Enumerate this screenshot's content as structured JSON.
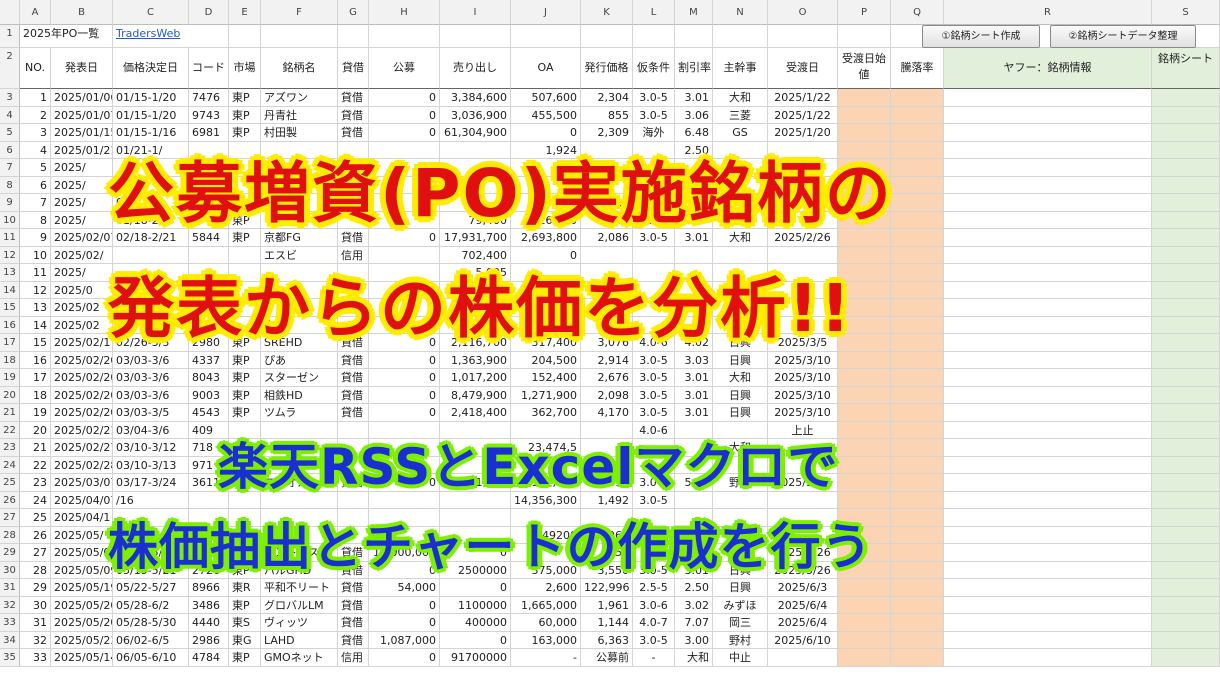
{
  "columns": [
    "A",
    "B",
    "C",
    "D",
    "E",
    "F",
    "G",
    "H",
    "I",
    "J",
    "K",
    "L",
    "M",
    "N",
    "O",
    "P",
    "Q",
    "R",
    "S"
  ],
  "row1": {
    "title": "2025年PO一覧",
    "link": "TradersWeb",
    "btn1": "①銘柄シート作成",
    "btn2": "②銘柄シートデータ整理"
  },
  "header": [
    "NO.",
    "発表日",
    "価格決定日",
    "コード",
    "市場",
    "銘柄名",
    "貸借",
    "公募",
    "売り出し",
    "OA",
    "発行価格",
    "仮条件",
    "割引率",
    "主幹事",
    "受渡日",
    "受渡日始値",
    "騰落率",
    "ヤフー：銘柄情報",
    "銘柄シート"
  ],
  "rows": [
    [
      "1",
      "2025/01/06",
      "01/15-1/20",
      "7476",
      "東P",
      "アズワン",
      "貸借",
      "0",
      "3,384,600",
      "507,600",
      "2,304",
      "3.0-5",
      "3.01",
      "大和",
      "2025/1/22"
    ],
    [
      "2",
      "2025/01/07",
      "01/15-1/20",
      "9743",
      "東P",
      "丹青社",
      "貸借",
      "0",
      "3,036,900",
      "455,500",
      "855",
      "3.0-5",
      "3.06",
      "三菱",
      "2025/1/22"
    ],
    [
      "3",
      "2025/01/15",
      "01/15-1/16",
      "6981",
      "東P",
      "村田製",
      "貸借",
      "0",
      "61,304,900",
      "0",
      "2,309",
      "海外",
      "6.48",
      "GS",
      "2025/1/20"
    ],
    [
      "4",
      "2025/01/21",
      "01/21-1/",
      "",
      "",
      "",
      "",
      "",
      "",
      "1,924",
      "",
      "",
      "2.50",
      "",
      ""
    ],
    [
      "5",
      "2025/",
      "",
      "",
      "",
      "",
      "",
      "",
      "",
      "",
      "",
      "",
      "",
      "",
      ""
    ],
    [
      "6",
      "2025/",
      "",
      "",
      "",
      "",
      "",
      "",
      "",
      "",
      "",
      "",
      "10.",
      "",
      ""
    ],
    [
      "7",
      "2025/",
      "01/17-2/",
      "",
      "",
      "",
      "",
      "",
      "",
      "920,9",
      "138,0",
      "",
      "3.5-",
      "",
      ""
    ],
    [
      "8",
      "2025/",
      "01/18-2/",
      "",
      "東P",
      "",
      "",
      "",
      "79,400",
      "116,900",
      "2,083",
      "3.",
      "",
      "",
      ""
    ],
    [
      "9",
      "2025/02/07",
      "02/18-2/21",
      "5844",
      "東P",
      "京都FG",
      "貸借",
      "0",
      "17,931,700",
      "2,693,800",
      "2,086",
      "3.0-5",
      "3.01",
      "大和",
      "2025/2/26"
    ],
    [
      "10",
      "2025/02/",
      "",
      "",
      "",
      "エスビ",
      "信用",
      "",
      "702,400",
      "0",
      "",
      "",
      "",
      "",
      ""
    ],
    [
      "11",
      "2025/",
      "",
      "",
      "",
      "",
      "",
      "",
      "5,095",
      "",
      "",
      "",
      "",
      "",
      ""
    ],
    [
      "12",
      "2025/0",
      "",
      "",
      "",
      "",
      "",
      "",
      "7,6",
      "",
      "",
      "",
      "",
      "",
      ""
    ],
    [
      "13",
      "2025/02",
      "",
      "",
      "",
      "",
      "",
      "",
      "2,70",
      "",
      "",
      "",
      "",
      "",
      ""
    ],
    [
      "14",
      "2025/02",
      "",
      "19",
      "",
      "高砂",
      "",
      "",
      "3,106,800",
      "466,000",
      "",
      "",
      "",
      "",
      ""
    ],
    [
      "15",
      "2025/02/17",
      "02/26-3/3",
      "2980",
      "東P",
      "SREHD",
      "貸借",
      "0",
      "2,116,700",
      "317,400",
      "3,076",
      "4.0-6",
      "4.02",
      "日興",
      "2025/3/5"
    ],
    [
      "16",
      "2025/02/20",
      "03/03-3/6",
      "4337",
      "東P",
      "ぴあ",
      "貸借",
      "0",
      "1,363,900",
      "204,500",
      "2,914",
      "3.0-5",
      "3.03",
      "日興",
      "2025/3/10"
    ],
    [
      "17",
      "2025/02/20",
      "03/03-3/6",
      "8043",
      "東P",
      "スターゼン",
      "貸借",
      "0",
      "1,017,200",
      "152,400",
      "2,676",
      "3.0-5",
      "3.01",
      "大和",
      "2025/3/10"
    ],
    [
      "18",
      "2025/02/20",
      "03/03-3/6",
      "9003",
      "東P",
      "相鉄HD",
      "貸借",
      "0",
      "8,479,900",
      "1,271,900",
      "2,098",
      "3.0-5",
      "3.01",
      "日興",
      "2025/3/10"
    ],
    [
      "19",
      "2025/02/20",
      "03/03-3/5",
      "4543",
      "東P",
      "ツムラ",
      "貸借",
      "0",
      "2,418,400",
      "362,700",
      "4,170",
      "3.0-5",
      "3.01",
      "日興",
      "2025/3/10"
    ],
    [
      "20",
      "2025/02/21",
      "03/04-3/6",
      "409",
      "",
      "",
      "",
      "",
      "",
      "",
      "",
      "4.0-6",
      "",
      "",
      "上止"
    ],
    [
      "21",
      "2025/02/27",
      "03/10-3/12",
      "718",
      "",
      "",
      "",
      "",
      "",
      "23,474,5",
      "",
      "",
      "",
      "大和",
      ""
    ],
    [
      "22",
      "2025/02/28",
      "03/10-3/13",
      "971",
      "",
      "",
      "",
      "",
      "",
      "",
      "",
      "",
      "",
      "",
      ""
    ],
    [
      "23",
      "2025/03/07",
      "03/17-3/24",
      "3611",
      "東S",
      "マツオカ",
      "貸借",
      "0",
      "1,081,200",
      "162,100",
      "1,816",
      "3.0-5",
      "5.02",
      "野村",
      "2025/3/25"
    ],
    [
      "24",
      "2025/04/07",
      "/16",
      "",
      "",
      "",
      "",
      "",
      "",
      "14,356,300",
      "1,492",
      "3.0-5",
      "",
      "",
      ""
    ],
    [
      "25",
      "2025/04/1",
      "",
      "",
      "",
      "",
      "",
      "",
      "",
      "",
      "",
      "",
      "",
      "",
      ""
    ],
    [
      "26",
      "2025/05/",
      "",
      "",
      "",
      "",
      "",
      "",
      "",
      "49200",
      "969",
      "海外",
      "6.01",
      "",
      ""
    ],
    [
      "27",
      "2025/05/08",
      "05/19-5/22",
      "186A",
      "東G",
      "アストロスケ",
      "貸借",
      "18,000,000",
      "0",
      "0",
      "650",
      "海外",
      "9.97",
      "MS",
      "2025/5/26"
    ],
    [
      "28",
      "2025/05/09",
      "05/19-5/21",
      "2726",
      "東P",
      "パルGHD",
      "貸借",
      "0",
      "2500000",
      "375,000",
      "3,550",
      "3.0-5",
      "3.01",
      "日興",
      "2025/5/26"
    ],
    [
      "29",
      "2025/05/19",
      "05/22-5/27",
      "8966",
      "東R",
      "平和不リート",
      "貸借",
      "54,000",
      "0",
      "2,600",
      "122,996",
      "2.5-5",
      "2.50",
      "日興",
      "2025/6/3"
    ],
    [
      "30",
      "2025/05/20",
      "05/28-6/2",
      "3486",
      "東P",
      "グロバルLM",
      "貸借",
      "0",
      "1100000",
      "1,665,000",
      "1,961",
      "3.0-6",
      "3.02",
      "みずほ",
      "2025/6/4"
    ],
    [
      "31",
      "2025/05/20",
      "05/28-5/30",
      "4440",
      "東S",
      "ヴィッツ",
      "貸借",
      "0",
      "400000",
      "60,000",
      "1,144",
      "4.0-7",
      "7.07",
      "岡三",
      "2025/6/4"
    ],
    [
      "32",
      "2025/05/23",
      "06/02-6/5",
      "2986",
      "東G",
      "LAHD",
      "貸借",
      "1,087,000",
      "0",
      "163,000",
      "6,363",
      "3.0-5",
      "3.00",
      "野村",
      "2025/6/10"
    ],
    [
      "33",
      "2025/05/14",
      "06/05-6/10",
      "4784",
      "東P",
      "GMOネット",
      "信用",
      "0",
      "91700000",
      "-",
      "公募前",
      "-",
      "大和",
      "中止",
      ""
    ]
  ],
  "overlay": {
    "line1": "公募増資(PO)実施銘柄の",
    "line2": "発表からの株価を分析!!",
    "line3": "楽天RSSとExcelマクロで",
    "line4": "株価抽出とチャートの作成を行う"
  },
  "colors": {
    "red": "#e01010",
    "yellow": "#ffec00",
    "blue": "#1a2fd0",
    "green": "#7df000",
    "salmon": "#fbd4b4",
    "lightgreen": "#e2efda"
  }
}
